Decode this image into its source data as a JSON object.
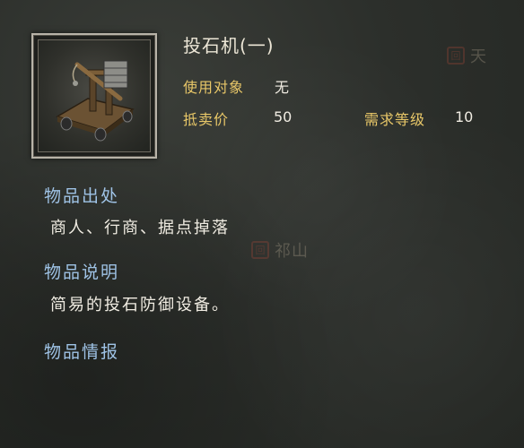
{
  "item": {
    "name": "投石机(一)",
    "icon": "catapult-icon",
    "target_label": "使用对象",
    "target_value": "无",
    "price_label": "抵卖价",
    "price_value": "50",
    "level_label": "需求等级",
    "level_value": "10"
  },
  "sections": {
    "source_heading": "物品出处",
    "source_text": "商人、行商、据点掉落",
    "desc_heading": "物品说明",
    "desc_text": "简易的投石防御设备。",
    "intel_heading": "物品情报"
  },
  "background": {
    "marker1_text": "天",
    "marker2_text": "祁山",
    "seal_char": "回"
  },
  "colors": {
    "label_gold": "#e8c768",
    "heading_blue": "#9fc3e6",
    "text_white": "#f0ece2"
  }
}
